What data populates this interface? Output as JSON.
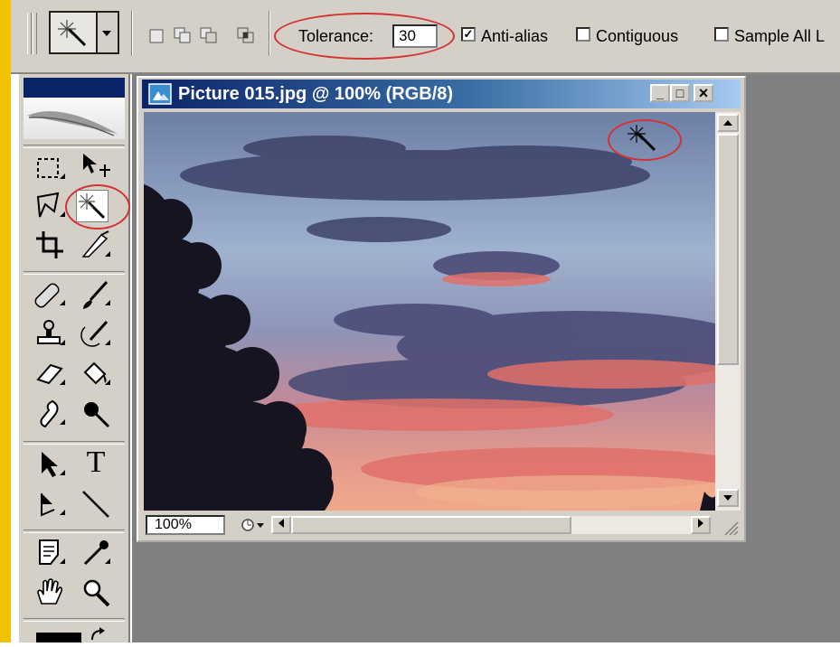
{
  "options_bar": {
    "tolerance_label": "Tolerance:",
    "tolerance_value": "30",
    "anti_alias_label": "Anti-alias",
    "anti_alias_checked": true,
    "contiguous_label": "Contiguous",
    "contiguous_checked": false,
    "sample_all_label": "Sample All L",
    "sample_all_checked": false
  },
  "document": {
    "title": "Picture 015.jpg @ 100% (RGB/8)",
    "zoom": "100%",
    "minimize": "_",
    "maximize": "□",
    "close": "×"
  },
  "colors": {
    "highlight_ring": "#d23333",
    "title_bar_start": "#0a246a",
    "title_bar_end": "#a6caf0",
    "ui_gray": "#d4d0c8",
    "workspace_gray": "#808080",
    "accent_stripe": "#f2c200"
  },
  "tools": [
    {
      "icon": "marquee-icon"
    },
    {
      "icon": "move-icon"
    },
    {
      "icon": "lasso-icon"
    },
    {
      "icon": "magic-wand-icon",
      "selected": true
    },
    {
      "icon": "crop-icon"
    },
    {
      "icon": "slice-icon"
    },
    {
      "icon": "healing-brush-icon"
    },
    {
      "icon": "brush-icon"
    },
    {
      "icon": "clone-stamp-icon"
    },
    {
      "icon": "history-brush-icon"
    },
    {
      "icon": "eraser-icon"
    },
    {
      "icon": "paint-bucket-icon"
    },
    {
      "icon": "smudge-icon"
    },
    {
      "icon": "burn-icon"
    },
    {
      "icon": "path-selection-icon"
    },
    {
      "icon": "type-icon"
    },
    {
      "icon": "pen-icon"
    },
    {
      "icon": "line-icon"
    },
    {
      "icon": "notes-icon"
    },
    {
      "icon": "eyedropper-icon"
    },
    {
      "icon": "hand-icon"
    },
    {
      "icon": "zoom-icon"
    }
  ],
  "type_tool_glyph": "T"
}
